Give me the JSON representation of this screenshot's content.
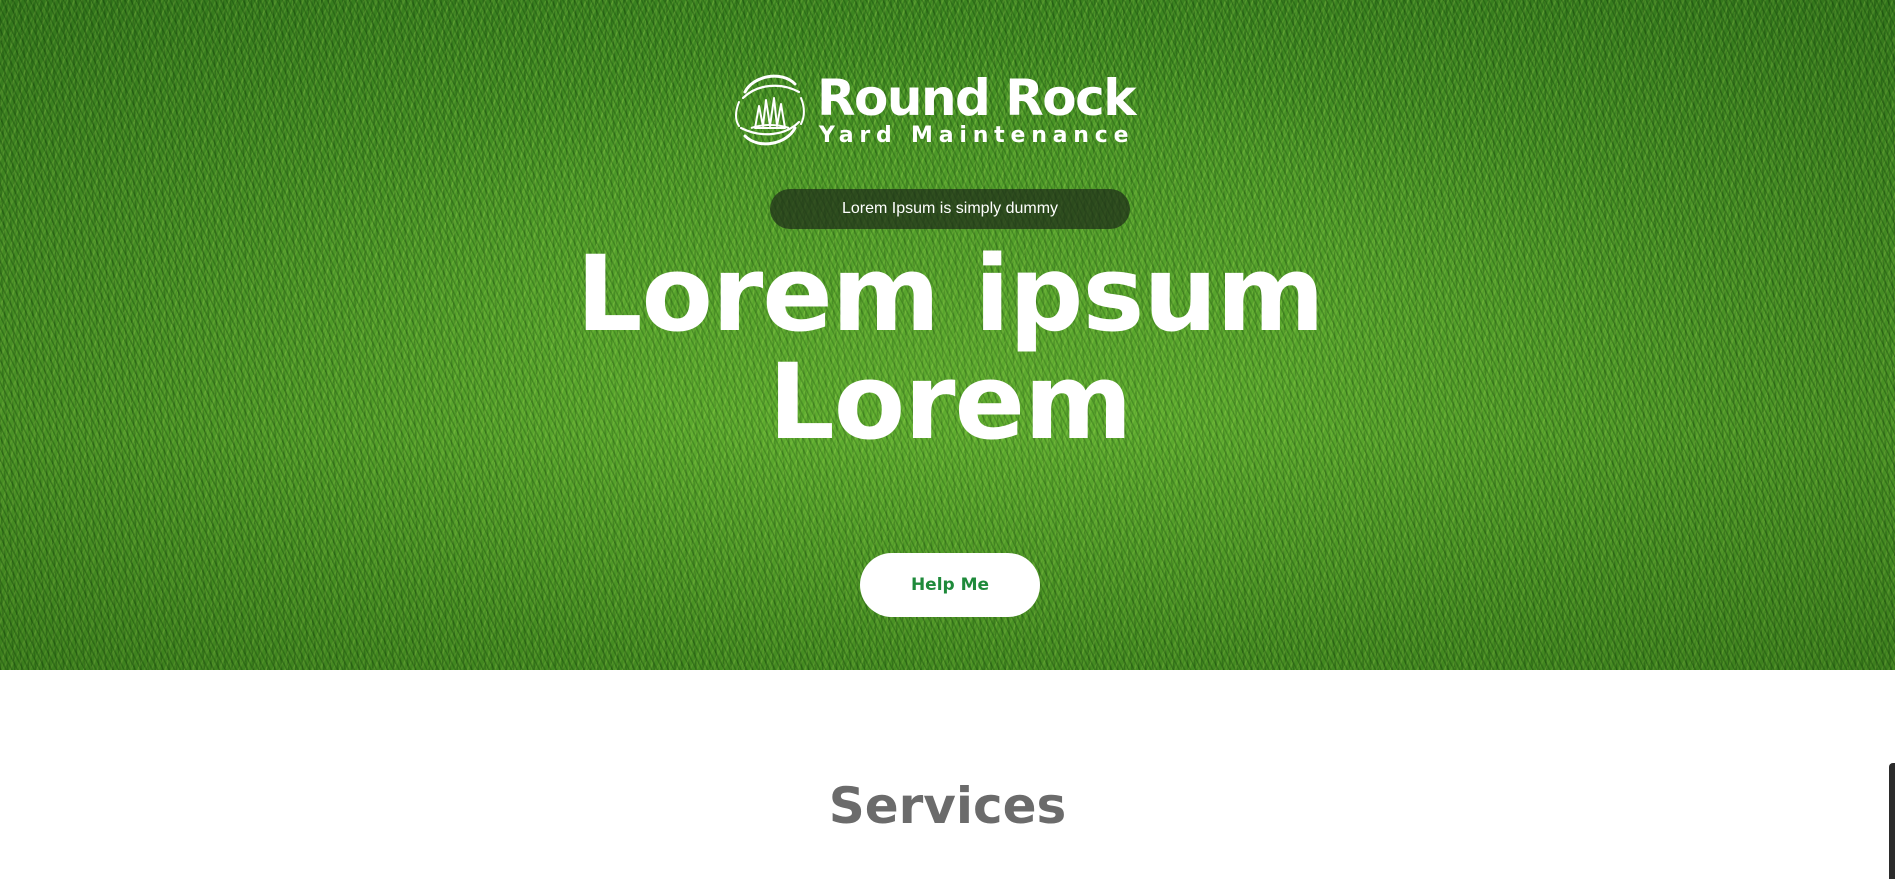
{
  "brand": {
    "title": "Round Rock",
    "subtitle": "Yard Maintenance",
    "icon": "grass-circle-logo-icon"
  },
  "hero": {
    "tagline": "Lorem Ipsum is simply dummy",
    "headline_line1": "Lorem ipsum",
    "headline_line2": "Lorem",
    "cta_label": "Help Me"
  },
  "sections": {
    "services_title": "Services"
  },
  "colors": {
    "grass": "#4d9a28",
    "cta_text": "#1e8a3a",
    "heading_gray": "#6b6b6b",
    "pill_bg": "#1e2d19"
  }
}
